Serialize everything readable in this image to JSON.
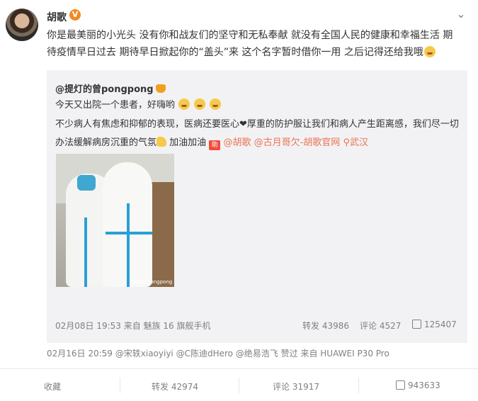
{
  "post": {
    "author": "胡歌",
    "verified_badge": "V",
    "more_icon": "chevron-down-icon",
    "text_a": "你是最美丽的小光头 没有你和战友们的坚守和无私奉献 就没有全国人民的健康和幸福生活 期待疫情早日过去 期待早日掀起你的“盖头”来 这个名字暂时借你一用 之后记得还给我哦",
    "timestamp": "02月16日 20:59",
    "likes_text": "@宋轶xiaoyiyi @C陈迪dHero @绝易浩飞 赞过",
    "source": "来自 HUAWEI P30 Pro"
  },
  "repost": {
    "author": "@提灯的曾pongpong",
    "line1": "今天又出院一个患者，好嗨哟",
    "body_a": "不少病人有焦虑和抑郁的表现，医病还要医心",
    "body_b": "厚重的防护服让我们和病人产生距离感，我们尽一切办法缓解病房沉重的气氛",
    "body_c": "加油加油",
    "mention1": "@胡歌",
    "mention2": "@古月哥欠-胡歌官网",
    "location": "武汉",
    "photo_watermark": "微博@pongpong",
    "timestamp": "02月08日 19:53",
    "source": "来自 魅族 16 旗舰手机",
    "reposts": "转发 43986",
    "comments": "评论 4527",
    "likes": "125407"
  },
  "actions": {
    "favorite": "收藏",
    "repost": "转发 42974",
    "comment": "评论 31917",
    "like": "943633"
  },
  "colors": {
    "accent": "#eb7350",
    "repost_bg": "#f2f2f5",
    "meta_text": "#808080",
    "verified": "#f08a24"
  }
}
